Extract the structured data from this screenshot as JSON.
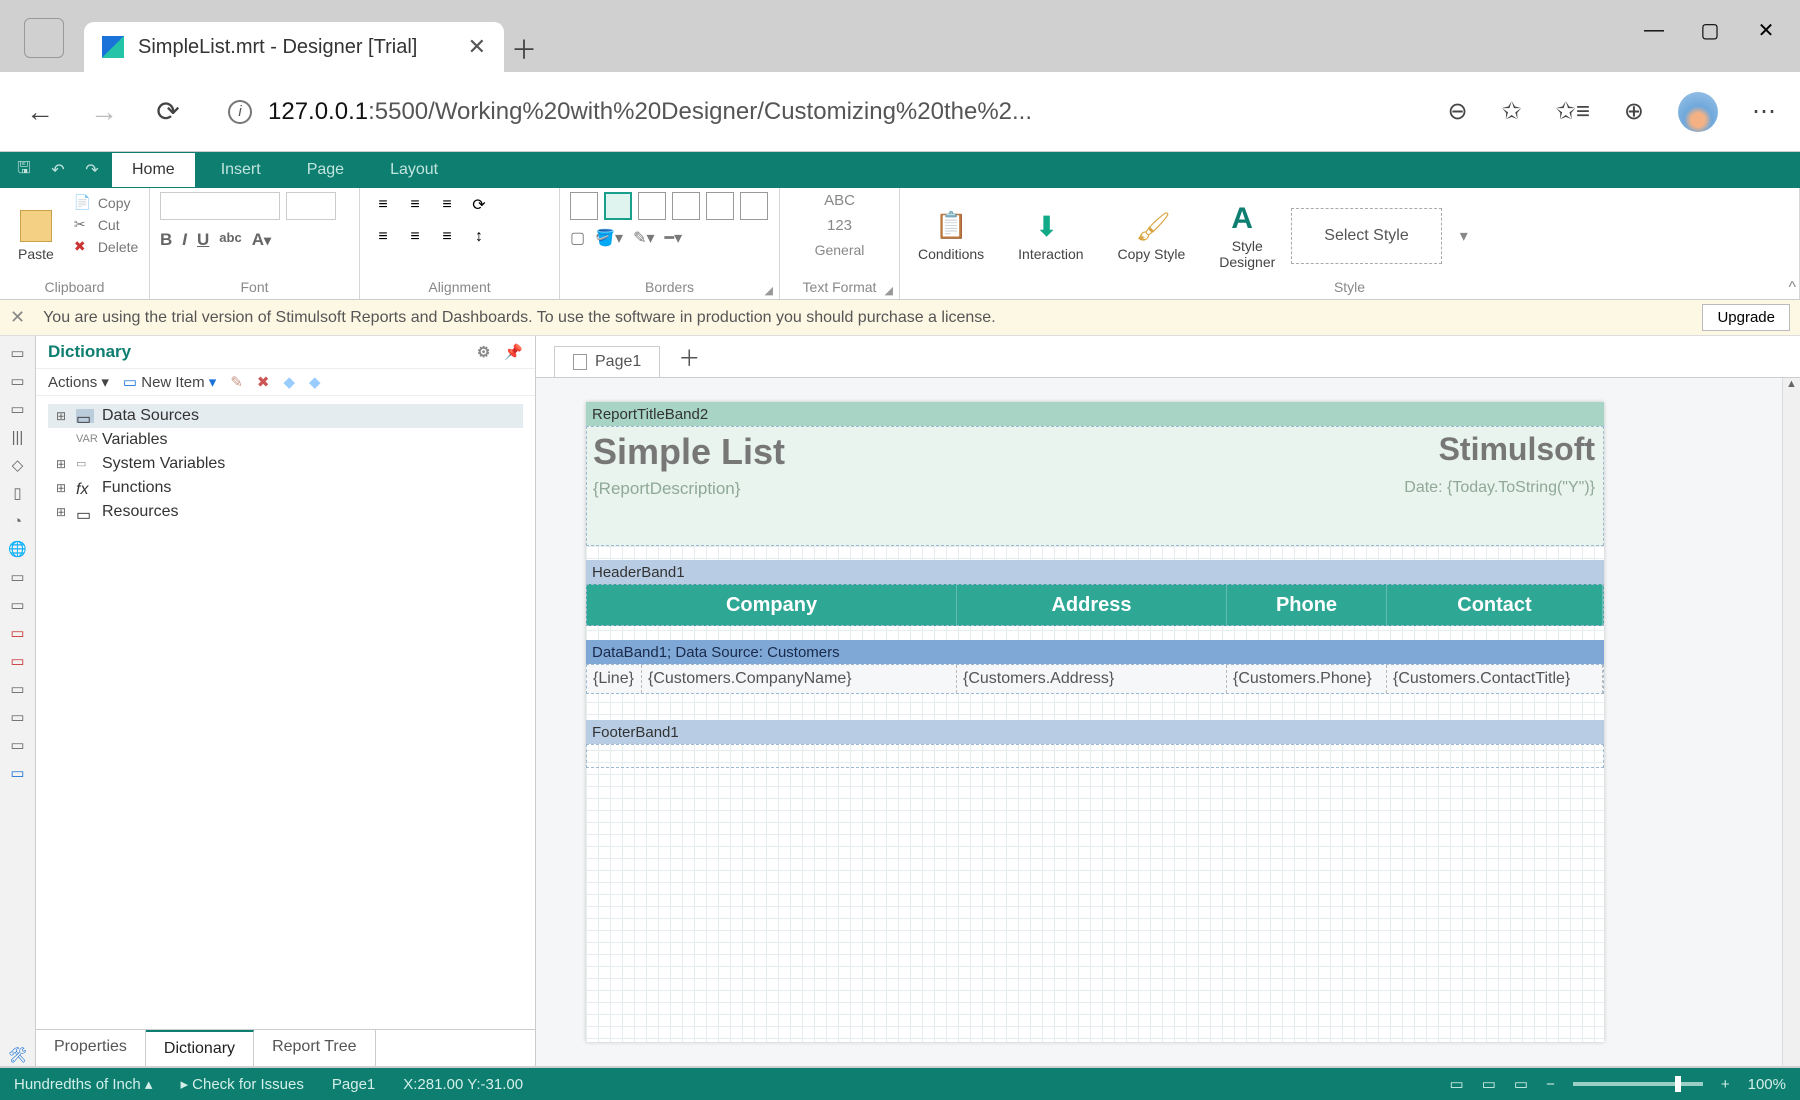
{
  "browser": {
    "tab_title": "SimpleList.mrt - Designer [Trial]",
    "url_host": "127.0.0.1",
    "url_port": ":5500",
    "url_path": "/Working%20with%20Designer/Customizing%20the%2..."
  },
  "ribbon": {
    "tabs": {
      "home": "Home",
      "insert": "Insert",
      "page": "Page",
      "layout": "Layout"
    },
    "clipboard": {
      "paste": "Paste",
      "copy": "Copy",
      "cut": "Cut",
      "delete": "Delete",
      "group": "Clipboard"
    },
    "font_group": "Font",
    "alignment_group": "Alignment",
    "borders_group": "Borders",
    "textformat": {
      "abc": "ABC",
      "num": "123",
      "general": "General",
      "group": "Text Format"
    },
    "conditions": "Conditions",
    "interaction": "Interaction",
    "copy_style": "Copy Style",
    "style_designer": "Style\nDesigner",
    "select_style": "Select Style",
    "style_group": "Style"
  },
  "trial": {
    "msg": "You are using the trial version of Stimulsoft Reports and Dashboards. To use the software in production you should purchase a license.",
    "upgrade": "Upgrade"
  },
  "dictionary": {
    "title": "Dictionary",
    "actions": "Actions",
    "new_item": "New Item",
    "tree": {
      "data_sources": "Data Sources",
      "variables": "Variables",
      "system_variables": "System Variables",
      "functions": "Functions",
      "resources": "Resources"
    },
    "tabs": {
      "properties": "Properties",
      "dictionary": "Dictionary",
      "report_tree": "Report Tree"
    }
  },
  "page_tab": "Page1",
  "report": {
    "title_band": "ReportTitleBand2",
    "title_h1": "Simple List",
    "brand": "Stimulsoft",
    "desc": "{ReportDescription}",
    "date": "Date: {Today.ToString(\"Y\")}",
    "header_band": "HeaderBand1",
    "columns": {
      "company": "Company",
      "address": "Address",
      "phone": "Phone",
      "contact": "Contact"
    },
    "data_band": "DataBand1; Data Source: Customers",
    "data_cells": {
      "line": "{Line}",
      "company": "{Customers.CompanyName}",
      "address": "{Customers.Address}",
      "phone": "{Customers.Phone}",
      "contact": "{Customers.ContactTitle}"
    },
    "footer_band": "FooterBand1"
  },
  "status": {
    "units": "Hundredths of Inch",
    "check": "Check for Issues",
    "page": "Page1",
    "coords": "X:281.00 Y:-31.00",
    "zoom": "100%"
  }
}
